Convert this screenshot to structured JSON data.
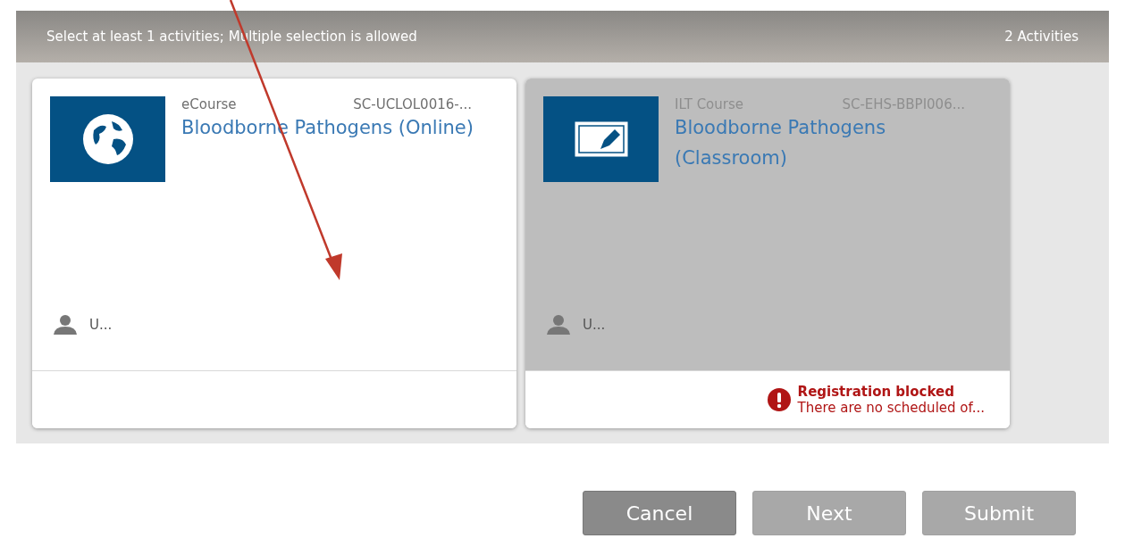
{
  "header": {
    "instruction": "Select at least 1 activities; Multiple selection is allowed",
    "count": "2 Activities"
  },
  "activities": [
    {
      "kind": "ecourse",
      "type": "eCourse",
      "code": "SC-UCLOL0016-...",
      "title": "Bloodborne Pathogens (Online)",
      "instructor": "U...",
      "disabled": false
    },
    {
      "kind": "ilt",
      "type": "ILT Course",
      "code": "SC-EHS-BBPI006...",
      "title": "Bloodborne Pathogens (Classroom)",
      "instructor": "U...",
      "disabled": true,
      "status": {
        "title": "Registration blocked",
        "message": "There are no scheduled of..."
      }
    }
  ],
  "buttons": [
    {
      "label": "Cancel",
      "disabled": false
    },
    {
      "label": "Next",
      "disabled": true
    },
    {
      "label": "Submit",
      "disabled": true
    }
  ]
}
